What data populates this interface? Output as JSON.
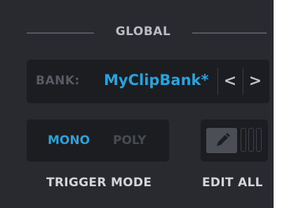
{
  "global": {
    "section_title": "GLOBAL",
    "bank": {
      "label": "BANK:",
      "value": "MyClipBank*",
      "prev_icon": "<",
      "next_icon": ">"
    },
    "trigger_mode": {
      "options": [
        "MONO",
        "POLY"
      ],
      "selected": "MONO",
      "caption": "TRIGGER MODE"
    },
    "edit_all": {
      "caption": "EDIT ALL",
      "icon": "pencil-icon"
    }
  },
  "colors": {
    "panel_bg": "#282a2f",
    "field_bg": "#1b1d21",
    "accent": "#29a3dc",
    "inactive_text": "#474b52",
    "label_text": "#d2d5da"
  }
}
